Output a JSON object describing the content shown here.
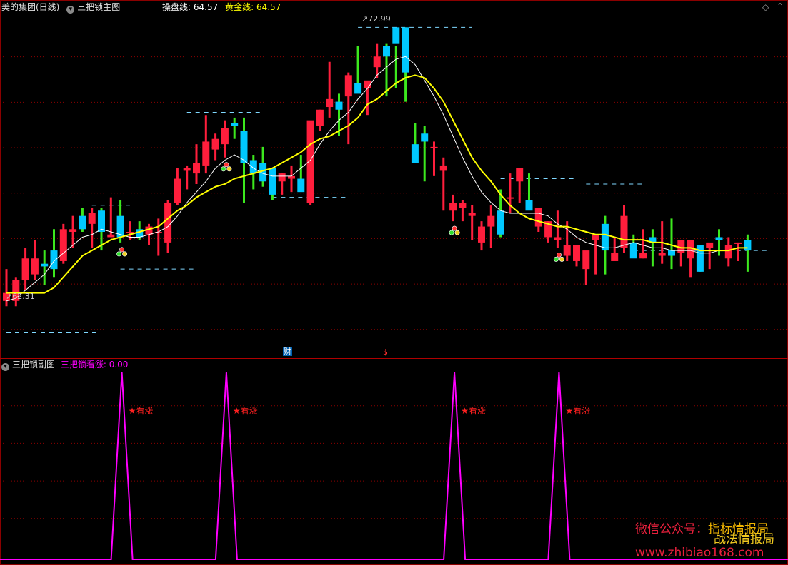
{
  "main_panel": {
    "stock_name": "美的集团(日线)",
    "indicator_name": "三把锁主图",
    "line1_label": "操盘线:",
    "line1_value": "64.57",
    "line2_label": "黄金线:",
    "line2_value": "64.57",
    "high_label": "72.99",
    "low_label": "62.31",
    "event_label_cai": "财",
    "event_label_dollar": "$"
  },
  "sub_panel": {
    "title": "三把锁副图",
    "series_label": "三把锁看涨:",
    "series_value": "0.00",
    "signal_label": "★看涨"
  },
  "watermark": {
    "line1_left": "微信公众号：",
    "line1_right": "指标情报局",
    "line2": "战法情报局",
    "line3": "www.zhibiao168.com"
  },
  "colors": {
    "up": "#ff1e3c",
    "down": "#00c8ff",
    "wick_green": "#3ce81e",
    "ma_yellow": "#ffff00",
    "ma_white": "#ffffff",
    "signal_magenta": "#ff00ff",
    "grid": "#8b0000"
  },
  "chart_data": {
    "type": "candlestick",
    "y_range": [
      60.5,
      73.5
    ],
    "y_high": 72.99,
    "y_low": 62.31,
    "candles": [
      [
        62.6,
        63.8,
        62.4,
        62.9
      ],
      [
        62.6,
        63.5,
        62.4,
        63.4
      ],
      [
        63.4,
        64.6,
        63.0,
        64.2
      ],
      [
        63.6,
        64.9,
        63.4,
        64.2
      ],
      [
        64.0,
        64.5,
        63.2,
        63.9
      ],
      [
        64.5,
        65.3,
        63.5,
        63.8
      ],
      [
        64.1,
        65.5,
        64.0,
        65.3
      ],
      [
        65.2,
        65.8,
        64.6,
        65.3
      ],
      [
        65.8,
        66.1,
        65.2,
        65.3
      ],
      [
        65.5,
        66.1,
        64.6,
        65.9
      ],
      [
        66.0,
        66.1,
        64.5,
        65.2
      ],
      [
        65.0,
        66.5,
        65.0,
        65.1
      ],
      [
        65.8,
        66.4,
        64.8,
        65.0
      ],
      [
        65.2,
        65.6,
        64.9,
        65.2
      ],
      [
        65.3,
        65.6,
        64.9,
        65.0
      ],
      [
        65.1,
        65.5,
        64.7,
        65.4
      ],
      [
        65.2,
        65.7,
        64.3,
        65.2
      ],
      [
        64.8,
        66.4,
        64.4,
        66.3
      ],
      [
        66.3,
        67.6,
        66.2,
        67.2
      ],
      [
        67.5,
        67.7,
        66.8,
        67.6
      ],
      [
        67.4,
        68.5,
        67.0,
        67.8
      ],
      [
        67.7,
        69.6,
        67.4,
        68.6
      ],
      [
        68.3,
        68.9,
        67.9,
        68.7
      ],
      [
        68.5,
        69.4,
        68.0,
        69.1
      ],
      [
        69.3,
        69.5,
        68.7,
        69.2
      ],
      [
        69.0,
        69.5,
        66.3,
        67.8
      ],
      [
        67.9,
        68.1,
        66.8,
        67.4
      ],
      [
        67.8,
        68.4,
        66.9,
        67.1
      ],
      [
        67.6,
        67.4,
        66.4,
        66.6
      ],
      [
        67.1,
        67.4,
        66.6,
        67.4
      ],
      [
        67.2,
        67.7,
        66.7,
        67.3
      ],
      [
        67.2,
        68.1,
        66.8,
        66.7
      ],
      [
        66.3,
        69.1,
        66.2,
        69.4
      ],
      [
        69.2,
        69.8,
        69.0,
        69.8
      ],
      [
        69.9,
        71.6,
        69.5,
        70.2
      ],
      [
        70.1,
        70.4,
        68.8,
        69.8
      ],
      [
        70.3,
        71.2,
        68.5,
        71.1
      ],
      [
        70.8,
        72.2,
        70.5,
        70.4
      ],
      [
        70.6,
        70.8,
        69.6,
        70.9
      ],
      [
        71.4,
        72.3,
        71.0,
        71.8
      ],
      [
        72.2,
        72.3,
        70.3,
        71.8
      ],
      [
        72.9,
        72.2,
        70.6,
        72.3
      ],
      [
        72.9,
        72.9,
        70.1,
        71.2
      ],
      [
        68.5,
        69.3,
        67.8,
        67.8
      ],
      [
        68.9,
        69.2,
        67.1,
        68.6
      ],
      [
        68.4,
        68.6,
        67.3,
        68.4
      ],
      [
        67.5,
        68.0,
        66.0,
        67.7
      ],
      [
        66.0,
        66.6,
        65.6,
        66.3
      ],
      [
        66.1,
        66.4,
        65.6,
        66.3
      ],
      [
        65.8,
        66.2,
        64.9,
        65.9
      ],
      [
        64.8,
        65.6,
        64.5,
        65.4
      ],
      [
        65.4,
        66.2,
        64.6,
        65.8
      ],
      [
        66.0,
        66.8,
        65.0,
        65.1
      ],
      [
        66.5,
        67.4,
        65.9,
        66.5
      ],
      [
        67.1,
        67.3,
        66.3,
        67.6
      ],
      [
        66.4,
        67.4,
        66.2,
        66.0
      ],
      [
        65.4,
        66.1,
        65.2,
        66.1
      ],
      [
        65.0,
        65.6,
        64.8,
        65.6
      ],
      [
        64.9,
        66.0,
        64.6,
        65.0
      ],
      [
        64.3,
        65.6,
        64.1,
        64.7
      ],
      [
        64.1,
        64.5,
        63.9,
        64.7
      ],
      [
        63.8,
        64.1,
        63.2,
        64.5
      ],
      [
        64.9,
        65.0,
        63.6,
        65.1
      ],
      [
        65.5,
        65.8,
        63.6,
        64.5
      ],
      [
        64.1,
        65.0,
        64.3,
        64.4
      ],
      [
        64.6,
        66.2,
        64.4,
        65.8
      ],
      [
        64.8,
        65.1,
        64.4,
        64.2
      ],
      [
        64.2,
        65.3,
        64.2,
        64.4
      ],
      [
        65.0,
        65.3,
        63.9,
        64.8
      ],
      [
        64.3,
        65.6,
        64.0,
        64.4
      ],
      [
        64.5,
        65.7,
        63.8,
        64.3
      ],
      [
        64.4,
        64.8,
        63.9,
        64.9
      ],
      [
        64.2,
        64.5,
        63.5,
        64.9
      ],
      [
        64.7,
        64.1,
        63.7,
        63.7
      ],
      [
        64.6,
        64.7,
        63.8,
        64.8
      ],
      [
        65.0,
        65.3,
        64.3,
        64.9
      ],
      [
        64.2,
        65.0,
        63.9,
        64.7
      ],
      [
        64.8,
        64.8,
        64.1,
        64.8
      ],
      [
        64.9,
        65.1,
        63.7,
        64.5
      ]
    ],
    "ma_white": [
      62.6,
      62.7,
      63.0,
      63.3,
      63.6,
      64.1,
      64.4,
      64.7,
      65.0,
      65.1,
      65.3,
      65.2,
      65.1,
      65.0,
      65.0,
      65.1,
      65.2,
      65.4,
      65.8,
      66.3,
      66.7,
      67.1,
      67.6,
      67.9,
      68.1,
      67.9,
      67.6,
      67.4,
      67.3,
      67.3,
      67.3,
      67.6,
      67.9,
      68.5,
      69.0,
      69.4,
      69.7,
      70.2,
      70.6,
      71.1,
      71.4,
      71.7,
      71.8,
      71.5,
      70.9,
      70.3,
      69.6,
      68.8,
      68.0,
      67.3,
      66.7,
      66.3,
      66.0,
      65.9,
      65.9,
      65.9,
      65.9,
      65.8,
      65.5,
      65.3,
      65.0,
      64.8,
      64.7,
      64.6,
      64.6,
      64.7,
      64.8,
      64.7,
      64.6,
      64.6,
      64.5,
      64.5,
      64.5,
      64.4,
      64.4,
      64.5,
      64.5,
      64.6,
      64.6
    ],
    "ma_yellow": [
      62.9,
      62.9,
      62.9,
      62.9,
      62.9,
      63.1,
      63.5,
      63.9,
      64.3,
      64.5,
      64.7,
      64.9,
      65.0,
      65.1,
      65.2,
      65.3,
      65.4,
      65.7,
      66.0,
      66.2,
      66.5,
      66.7,
      66.9,
      67.0,
      67.2,
      67.3,
      67.4,
      67.5,
      67.6,
      67.8,
      68.0,
      68.2,
      68.5,
      68.7,
      68.8,
      69.0,
      69.2,
      69.5,
      70.0,
      70.2,
      70.5,
      70.8,
      71.0,
      71.1,
      71.0,
      70.6,
      70.1,
      69.4,
      68.7,
      68.0,
      67.5,
      67.1,
      66.6,
      66.2,
      65.9,
      65.7,
      65.6,
      65.5,
      65.4,
      65.4,
      65.3,
      65.2,
      65.1,
      65.1,
      65.0,
      64.9,
      64.9,
      64.9,
      64.8,
      64.8,
      64.7,
      64.6,
      64.6,
      64.5,
      64.5,
      64.5,
      64.5,
      64.6,
      64.6
    ],
    "signals_at_index": [
      12,
      23,
      47,
      58
    ],
    "sub_series_value_range": [
      0,
      1
    ]
  }
}
